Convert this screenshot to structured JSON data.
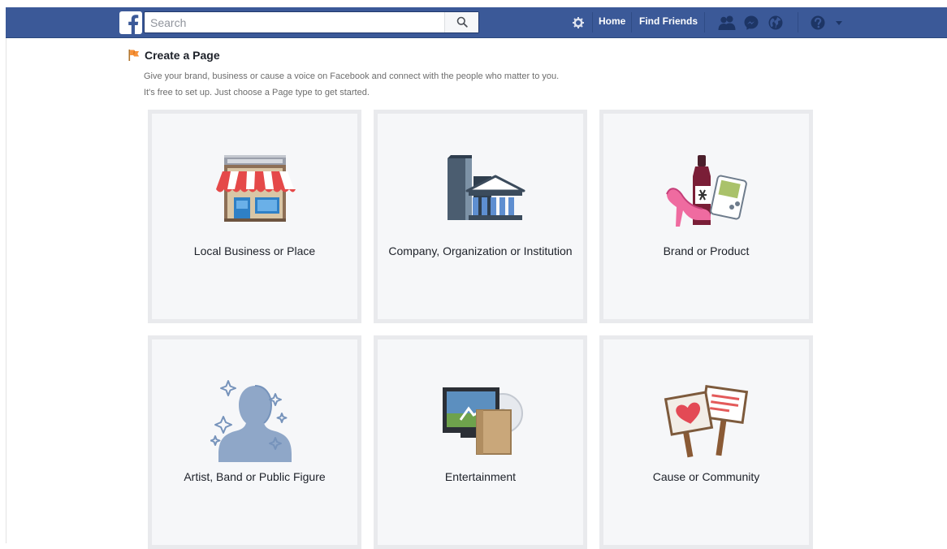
{
  "topbar": {
    "search_placeholder": "Search",
    "nav": {
      "home": "Home",
      "find_friends": "Find Friends"
    },
    "brand_color": "#3b5998"
  },
  "page": {
    "title": "Create a Page",
    "description_line1": "Give your brand, business or cause a voice on Facebook and connect with the people who matter to you.",
    "description_line2": "It's free to set up. Just choose a Page type to get started."
  },
  "categories": [
    {
      "label": "Local Business or Place",
      "icon": "storefront-icon"
    },
    {
      "label": "Company, Organization or Institution",
      "icon": "building-icon"
    },
    {
      "label": "Brand or Product",
      "icon": "brand-products-icon"
    },
    {
      "label": "Artist, Band or Public Figure",
      "icon": "public-figure-icon"
    },
    {
      "label": "Entertainment",
      "icon": "entertainment-icon"
    },
    {
      "label": "Cause or Community",
      "icon": "cause-signs-icon"
    }
  ]
}
